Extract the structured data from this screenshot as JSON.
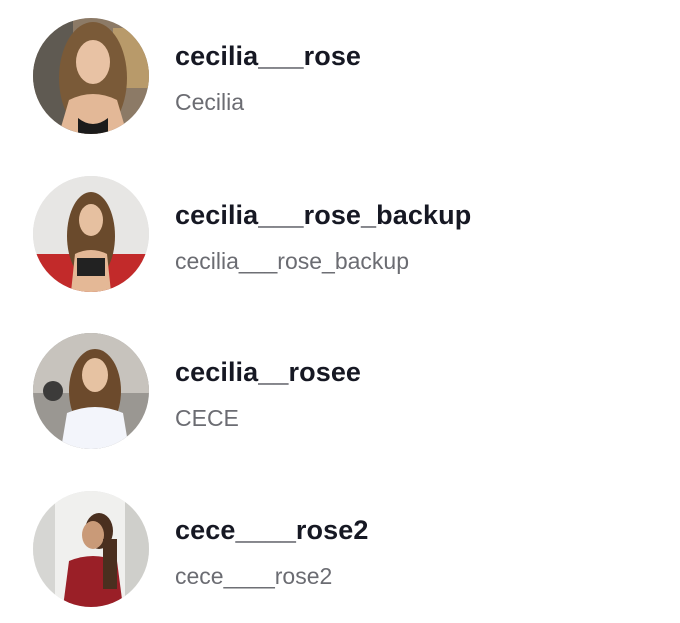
{
  "results": [
    {
      "username": "cecilia___rose",
      "nickname": "Cecilia",
      "avatar": "profile-photo"
    },
    {
      "username": "cecilia___rose_backup",
      "nickname": "cecilia___rose_backup",
      "avatar": "profile-photo"
    },
    {
      "username": "cecilia__rosee",
      "nickname": "CECE",
      "avatar": "profile-photo"
    },
    {
      "username": "cece____rose2",
      "nickname": "cece____rose2",
      "avatar": "profile-photo"
    }
  ],
  "colors": {
    "username": "#161823",
    "nickname": "#6b6c72",
    "background": "#ffffff"
  }
}
